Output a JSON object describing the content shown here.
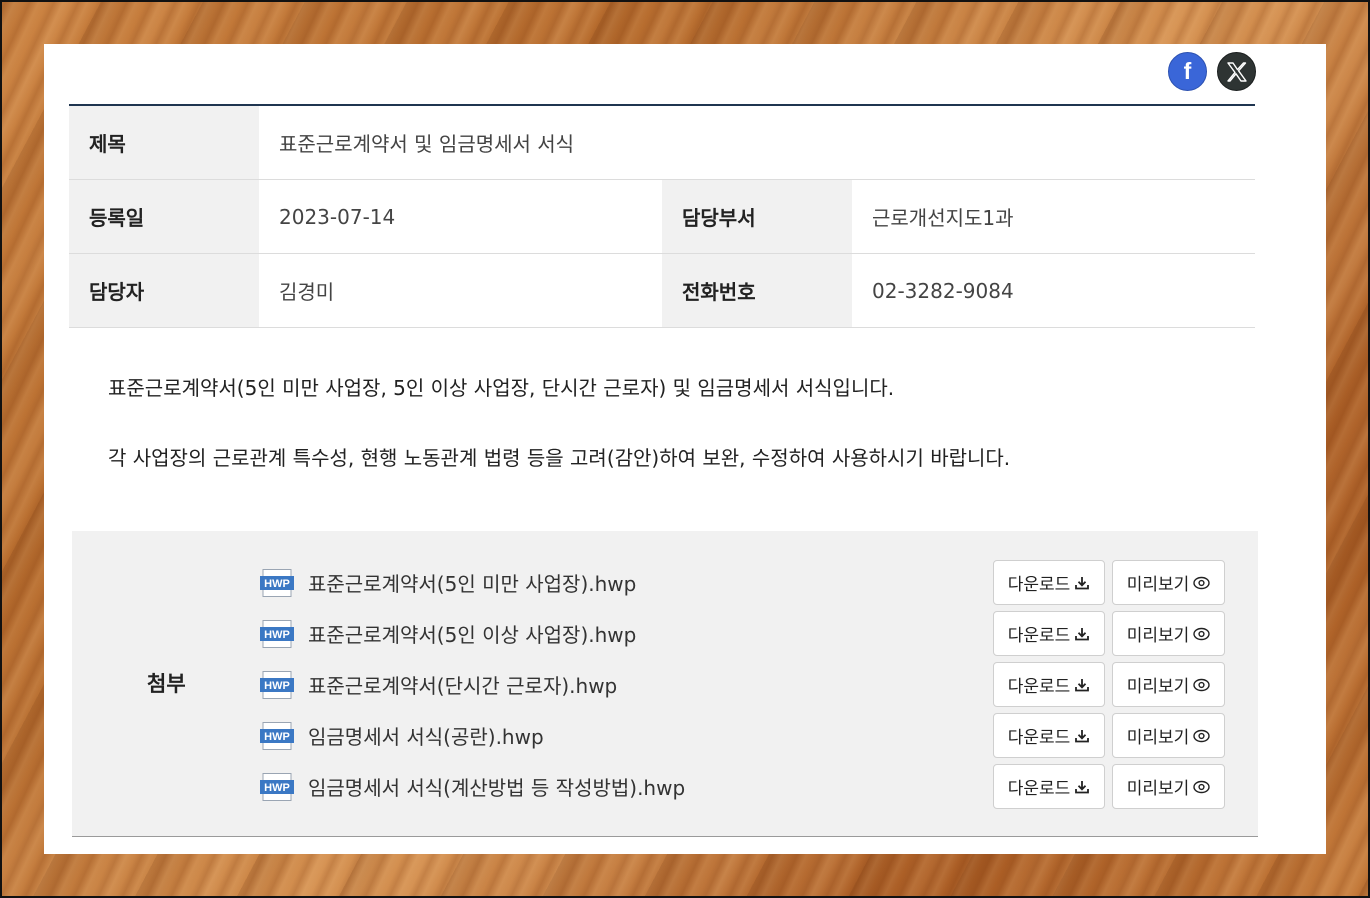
{
  "share": {
    "facebook_label": "f",
    "x_label": "X"
  },
  "info": {
    "title_label": "제목",
    "title_value": "표준근로계약서 및 임금명세서 서식",
    "date_label": "등록일",
    "date_value": "2023-07-14",
    "dept_label": "담당부서",
    "dept_value": "근로개선지도1과",
    "person_label": "담당자",
    "person_value": "김경미",
    "phone_label": "전화번호",
    "phone_value": "02-3282-9084"
  },
  "content": {
    "paragraph1": "표준근로계약서(5인 미만 사업장, 5인 이상 사업장, 단시간 근로자) 및 임금명세서 서식입니다.",
    "paragraph2": "각 사업장의 근로관계 특수성, 현행 노동관계 법령 등을 고려(감안)하여 보완, 수정하여 사용하시기 바랍니다."
  },
  "attachments": {
    "label": "첨부",
    "icon_text": "HWP",
    "download_label": "다운로드",
    "preview_label": "미리보기",
    "files": [
      "표준근로계약서(5인 미만 사업장).hwp",
      "표준근로계약서(5인 이상 사업장).hwp",
      "표준근로계약서(단시간 근로자).hwp",
      "임금명세서 서식(공란).hwp",
      "임금명세서 서식(계산방법 등 작성방법).hwp"
    ]
  },
  "colors": {
    "facebook": "#3a66d8",
    "x": "#2e3433",
    "header_line": "#1f3550",
    "hwp_blue": "#3b78c4"
  }
}
